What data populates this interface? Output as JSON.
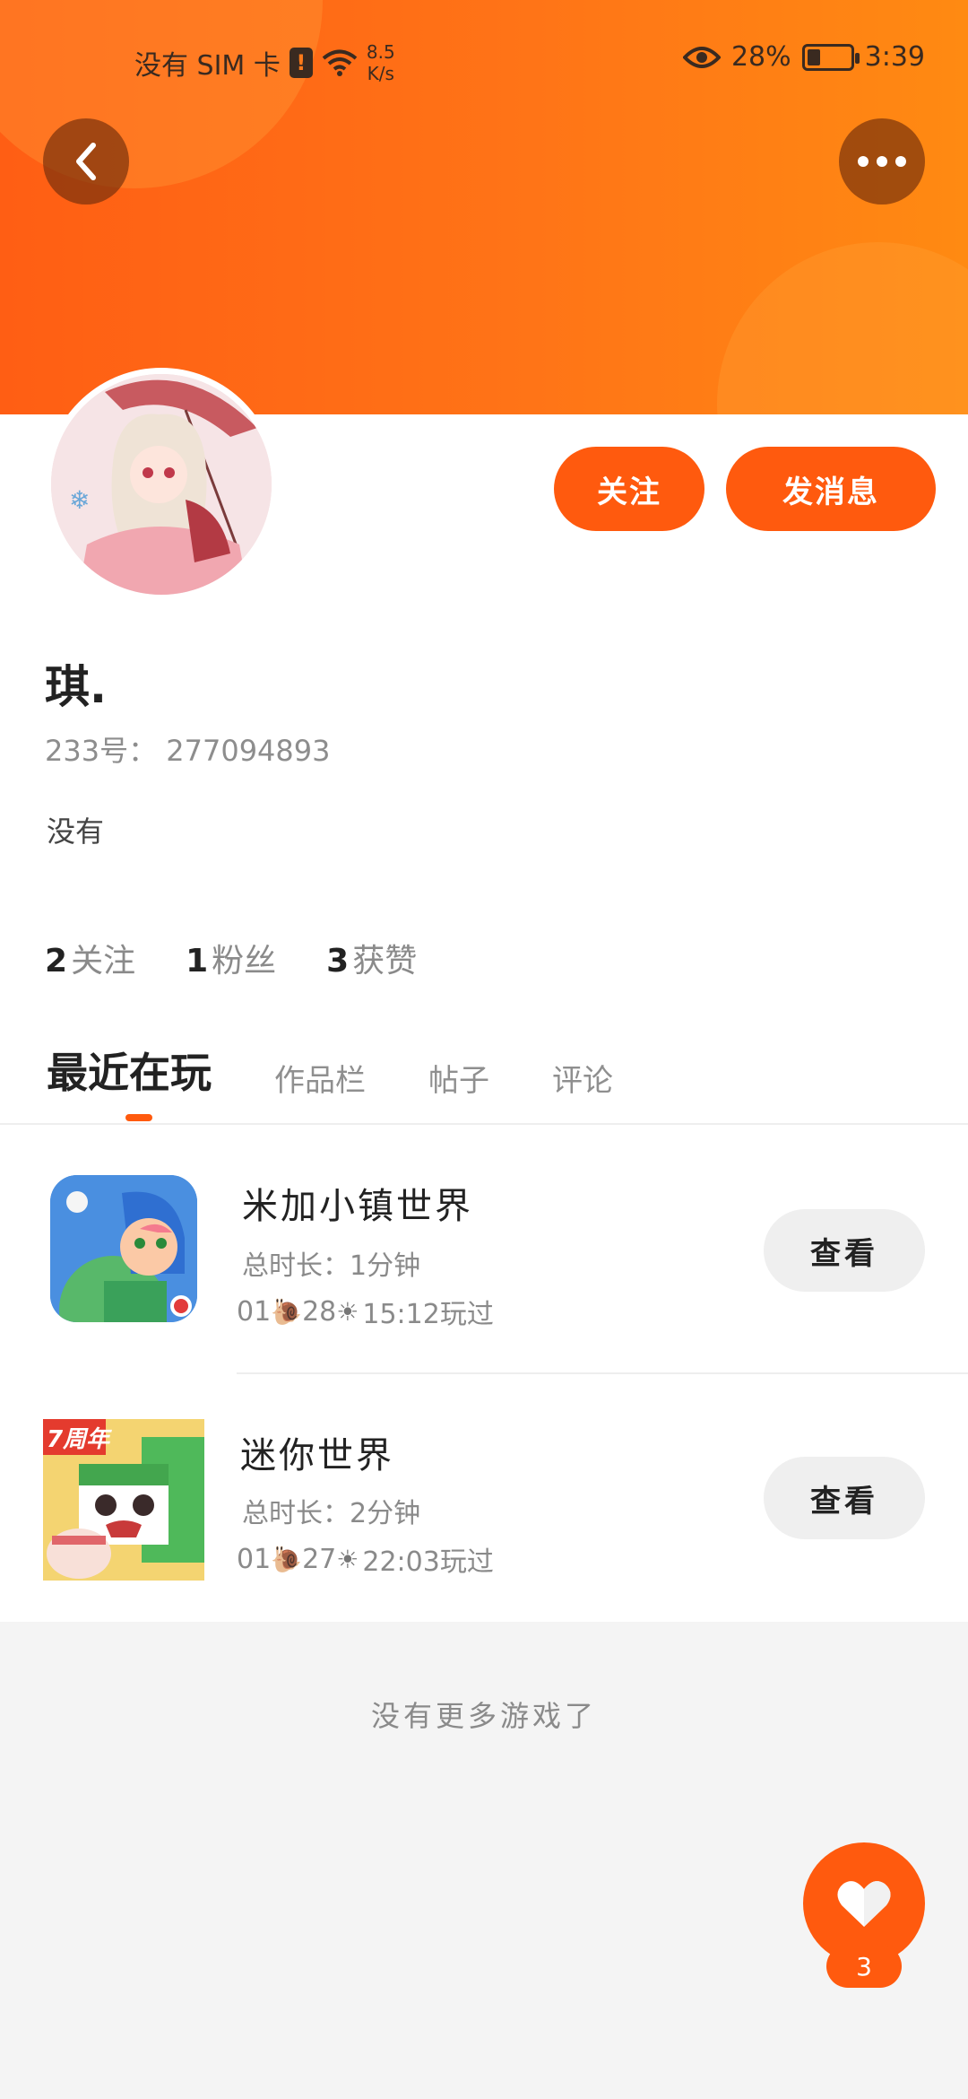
{
  "status_bar": {
    "carrier": "没有 SIM 卡",
    "sim_alert": "!",
    "net_speed_value": "8.5",
    "net_speed_unit": "K/s",
    "battery_percent": "28%",
    "time": "3:39"
  },
  "header": {
    "back_icon": "chevron-left-icon",
    "more_icon": "more-dots-icon"
  },
  "profile": {
    "username": "琪.",
    "uid": "233号： 277094893",
    "bio": "没有",
    "follow_label": "关注",
    "message_label": "发消息",
    "stats": [
      {
        "num": "2",
        "label": "关注"
      },
      {
        "num": "1",
        "label": "粉丝"
      },
      {
        "num": "3",
        "label": "获赞"
      }
    ]
  },
  "tabs": [
    "最近在玩",
    "作品栏",
    "帖子",
    "评论"
  ],
  "games": [
    {
      "title": "米加小镇世界",
      "duration": "总时长：1分钟",
      "played": "01",
      "played_day": "28",
      "played_time": "15:12玩过",
      "action": "查看"
    },
    {
      "title": "迷你世界",
      "duration": "总时长：2分钟",
      "played": "01",
      "played_day": "27",
      "played_time": "22:03玩过",
      "action": "查看",
      "icon_badge": "7周年"
    }
  ],
  "footer": {
    "no_more": "没有更多游戏了",
    "like_count": "3"
  },
  "colors": {
    "accent": "#ff5a0e",
    "header_start": "#ff5e14",
    "header_end": "#ff8a12"
  }
}
